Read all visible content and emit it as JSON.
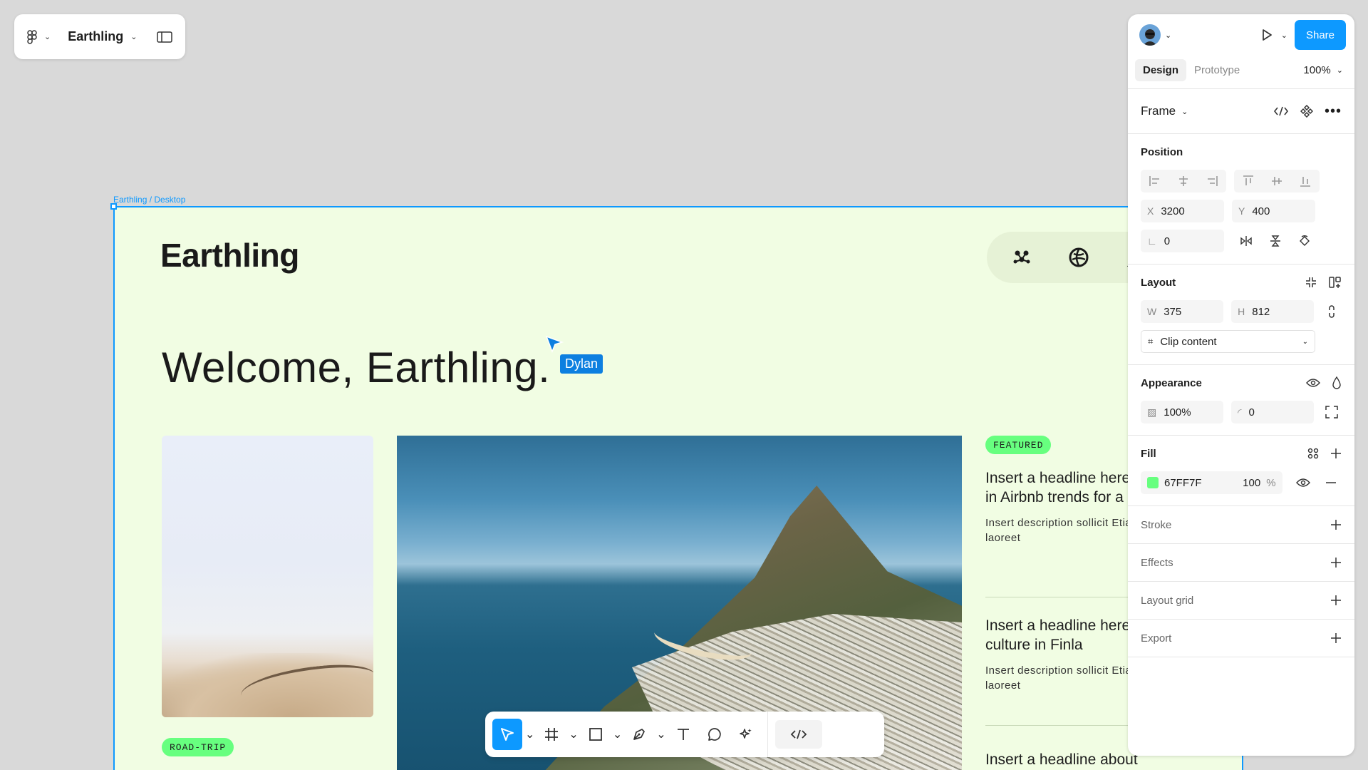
{
  "file_menu": {
    "file_name": "Earthling",
    "figma_icon": "figma-logo-icon",
    "panel_icon": "sidebar-toggle-icon"
  },
  "canvas": {
    "frame_label": "Earthling / Desktop",
    "frame_bg": "#f1fde3",
    "selection_color": "#0d99ff",
    "logo": "Earthling",
    "welcome": "Welcome, Earthling.",
    "nav_icons": [
      "community-icon",
      "globe-icon",
      "user-icon"
    ],
    "tags": {
      "road_trip": "ROAD-TRIP",
      "featured": "FEATURED"
    },
    "tag_color": "#67ff7f",
    "articles": [
      {
        "headline": "Insert a headline here about the latest in Airbnb trends for a large group gath",
        "description": "Insert description sollicit Etiam viverra, erat laoreet"
      },
      {
        "headline": "Insert a headline here about sauna culture in Finla",
        "description": "Insert description sollicit Etiam viverra, erat laoreet"
      },
      {
        "headline": "Insert a headline about",
        "description": ""
      }
    ],
    "collaborator": {
      "name": "Dylan",
      "color": "#0d7fe0"
    }
  },
  "toolbar": {
    "tools": [
      "move-tool",
      "frame-tool",
      "rectangle-tool",
      "pen-tool",
      "text-tool",
      "comment-tool",
      "actions-tool",
      "dev-mode-toggle"
    ]
  },
  "panel": {
    "share_label": "Share",
    "tabs": [
      "Design",
      "Prototype"
    ],
    "zoom": "100%",
    "frame_title": "Frame",
    "position": {
      "title": "Position",
      "x_label": "X",
      "x": "3200",
      "y_label": "Y",
      "y": "400",
      "rotation": "0"
    },
    "layout": {
      "title": "Layout",
      "w_label": "W",
      "w": "375",
      "h_label": "H",
      "h": "812",
      "clip": "Clip content"
    },
    "appearance": {
      "title": "Appearance",
      "opacity": "100%",
      "radius": "0"
    },
    "fill": {
      "title": "Fill",
      "hex": "67FF7F",
      "opacity": "100",
      "unit": "%",
      "swatch": "#67ff7f"
    },
    "stroke": "Stroke",
    "effects": "Effects",
    "layout_grid": "Layout grid",
    "export": "Export"
  }
}
